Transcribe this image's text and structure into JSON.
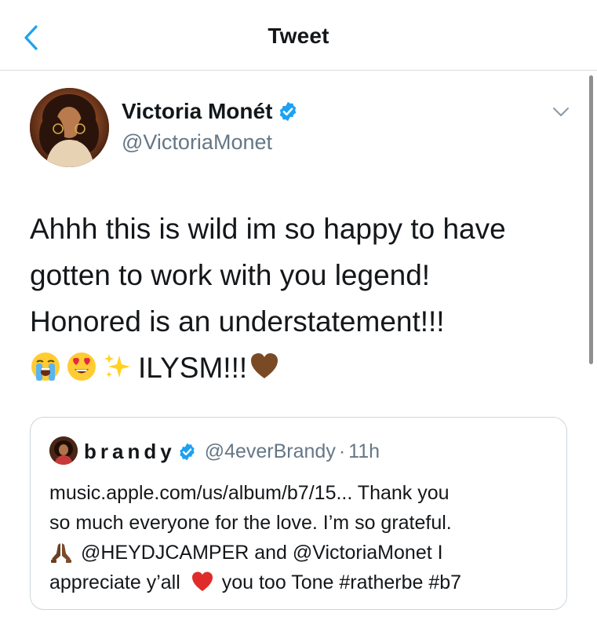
{
  "header": {
    "title": "Tweet",
    "back_icon": "chevron-left-icon"
  },
  "tweet": {
    "display_name": "Victoria Monét",
    "handle": "@VictoriaMonet",
    "verified": true,
    "text_lines": [
      "Ahhh this is wild im so happy to have",
      "gotten to work with you legend!",
      "Honored is an understatement!!!"
    ],
    "emoji_line": {
      "emojis": [
        "loudly-crying-face-emoji",
        "heart-eyes-emoji",
        "sparkles-emoji"
      ],
      "text": "ILYSM!!!",
      "trailing_emoji": "brown-heart-emoji"
    }
  },
  "quote": {
    "display_name": "brandy",
    "verified": true,
    "handle": "@4everBrandy",
    "separator": "·",
    "time": "11h",
    "lines": [
      "music.apple.com/us/album/b7/15... Thank you",
      "so much everyone for the love. I’m so grateful."
    ],
    "line3_emoji": "folded-hands-emoji",
    "line3_text": "@HEYDJCAMPER and @VictoriaMonet  I",
    "line4_text_a": "appreciate y’all",
    "line4_emoji": "red-heart-emoji",
    "line4_text_b": "you too Tone #ratherbe #b7"
  },
  "colors": {
    "text": "#14171a",
    "secondary": "#657786",
    "accent": "#1da1f2",
    "border": "#ccd6dd"
  }
}
